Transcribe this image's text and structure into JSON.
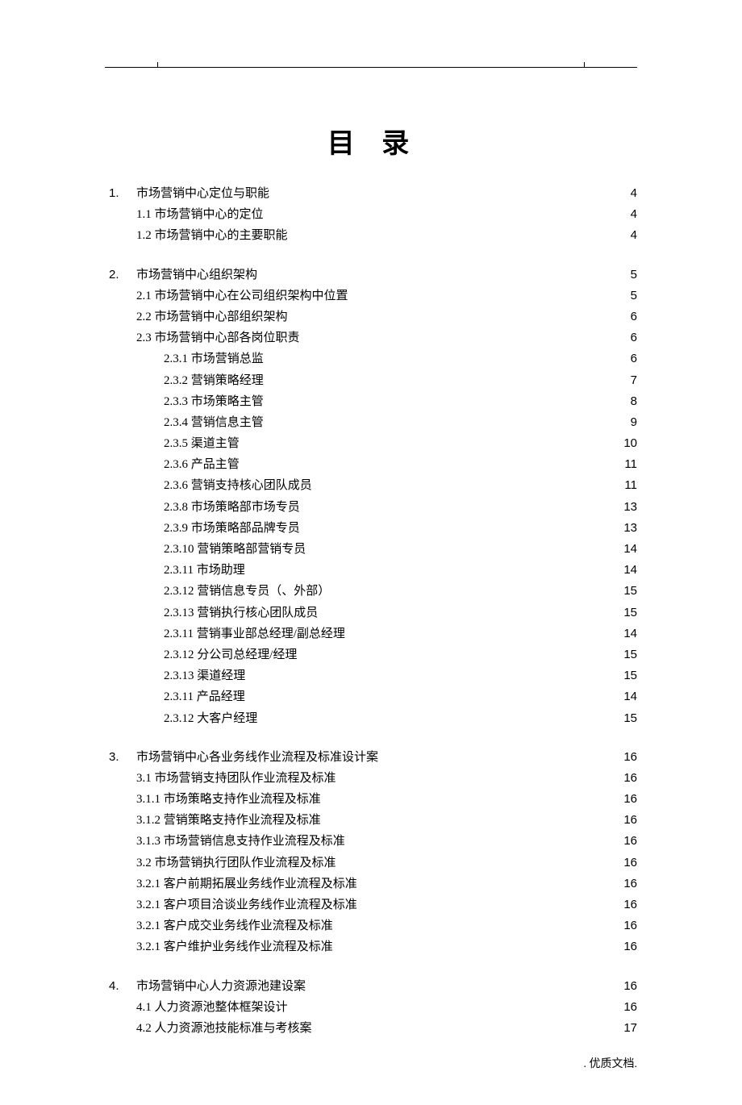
{
  "title": "目 录",
  "footer": ". 优质文档.",
  "toc": [
    {
      "num": "1.",
      "label": "市场营销中心定位与职能",
      "page": "4",
      "children": [
        {
          "label": "1.1 市场营销中心的定位",
          "page": "4"
        },
        {
          "label": "1.2 市场营销中心的主要职能",
          "page": "4"
        }
      ]
    },
    {
      "num": "2.",
      "label": "市场营销中心组织架构",
      "page": "5",
      "children": [
        {
          "label": "2.1 市场营销中心在公司组织架构中位置",
          "page": "5"
        },
        {
          "label": "2.2 市场营销中心部组织架构",
          "page": "6"
        },
        {
          "label": "2.3 市场营销中心部各岗位职责",
          "page": "6",
          "children": [
            {
              "label": "2.3.1 市场营销总监",
              "page": "6"
            },
            {
              "label": "2.3.2 营销策略经理",
              "page": "7"
            },
            {
              "label": "2.3.3 市场策略主管",
              "page": "8"
            },
            {
              "label": "2.3.4 营销信息主管",
              "page": "9"
            },
            {
              "label": "2.3.5 渠道主管",
              "page": "10"
            },
            {
              "label": "2.3.6 产品主管",
              "page": "11"
            },
            {
              "label": "2.3.6 营销支持核心团队成员",
              "page": "11"
            },
            {
              "label": "2.3.8 市场策略部市场专员",
              "page": "13"
            },
            {
              "label": "2.3.9 市场策略部品牌专员",
              "page": "13"
            },
            {
              "label": "2.3.10 营销策略部营销专员",
              "page": "14"
            },
            {
              "label": "2.3.11 市场助理",
              "page": "14"
            },
            {
              "label": "2.3.12 营销信息专员（、外部）",
              "page": "15"
            },
            {
              "label": "2.3.13 营销执行核心团队成员",
              "page": "15"
            },
            {
              "label": "2.3.11 营销事业部总经理/副总经理",
              "page": "14"
            },
            {
              "label": "2.3.12 分公司总经理/经理",
              "page": "15"
            },
            {
              "label": "2.3.13 渠道经理",
              "page": "15"
            },
            {
              "label": "2.3.11 产品经理",
              "page": "14"
            },
            {
              "label": "2.3.12 大客户经理",
              "page": "15"
            }
          ]
        }
      ]
    },
    {
      "num": "3.",
      "label": "市场营销中心各业务线作业流程及标准设计案",
      "page": "16",
      "children": [
        {
          "label": "3.1 市场营销支持团队作业流程及标准",
          "page": "16"
        },
        {
          "label": "3.1.1 市场策略支持作业流程及标准",
          "page": "16"
        },
        {
          "label": "3.1.2 营销策略支持作业流程及标准",
          "page": "16"
        },
        {
          "label": "3.1.3 市场营销信息支持作业流程及标准",
          "page": "16"
        },
        {
          "label": "3.2 市场营销执行团队作业流程及标准",
          "page": "16"
        },
        {
          "label": "3.2.1 客户前期拓展业务线作业流程及标准",
          "page": "16"
        },
        {
          "label": "3.2.1 客户项目洽谈业务线作业流程及标准",
          "page": "16"
        },
        {
          "label": "3.2.1 客户成交业务线作业流程及标准",
          "page": "16"
        },
        {
          "label": "3.2.1 客户维护业务线作业流程及标准",
          "page": "16"
        }
      ]
    },
    {
      "num": "4.",
      "label": "市场营销中心人力资源池建设案",
      "page": "16",
      "children": [
        {
          "label": "4.1 人力资源池整体框架设计",
          "page": "16"
        },
        {
          "label": "4.2 人力资源池技能标准与考核案",
          "page": "17"
        }
      ]
    }
  ]
}
